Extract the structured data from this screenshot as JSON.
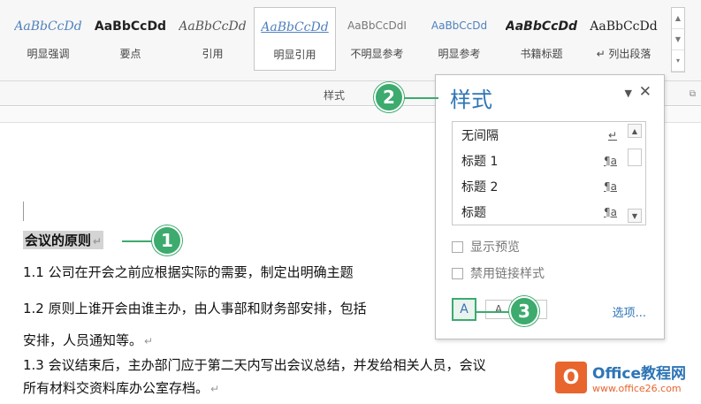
{
  "ribbon": {
    "gallery": [
      {
        "sample": "AaBbCcDd",
        "name": "明显强调"
      },
      {
        "sample": "AaBbCcDd",
        "name": "要点"
      },
      {
        "sample": "AaBbCcDd",
        "name": "引用"
      },
      {
        "sample": "AaBbCcDd",
        "name": "明显引用"
      },
      {
        "sample": "AaBbCcDdI",
        "name": "不明显参考"
      },
      {
        "sample": "AaBbCcDd",
        "name": "明显参考"
      },
      {
        "sample": "AaBbCcDd",
        "name": "书籍标题"
      },
      {
        "sample": "AaBbCcDd",
        "name": "↵ 列出段落"
      }
    ],
    "group_label": "样式"
  },
  "document": {
    "heading": "会议的原则",
    "p1": "1.1 公司在开会之前应根据实际的需要，制定出明确主题",
    "p2": "1.2 原则上谁开会由谁主办，由人事部和财务部安排，包括",
    "p3": "安排，人员通知等。",
    "p4": "1.3 会议结束后，主办部门应于第二天内写出会议总结，并发给相关人员，会议",
    "p5": "所有材料交资料库办公室存档。",
    "para_mark": "↵"
  },
  "styles_pane": {
    "title": "样式",
    "items": [
      {
        "label": "无间隔",
        "mark": "↵"
      },
      {
        "label": "标题 1",
        "mark": "¶a"
      },
      {
        "label": "标题 2",
        "mark": "¶a"
      },
      {
        "label": "标题",
        "mark": "¶a"
      }
    ],
    "show_preview": "显示预览",
    "disable_linked": "禁用链接样式",
    "new_style_icon": "new-style-icon",
    "options_link": "选项..."
  },
  "callouts": [
    "1",
    "2",
    "3"
  ],
  "watermark": {
    "logo": "O",
    "line1": "Office教程网",
    "line2": "www.office26.com"
  },
  "colors": {
    "accent_green": "#3daa6e",
    "link_blue": "#2e75b6",
    "brand_orange": "#e8652e"
  }
}
